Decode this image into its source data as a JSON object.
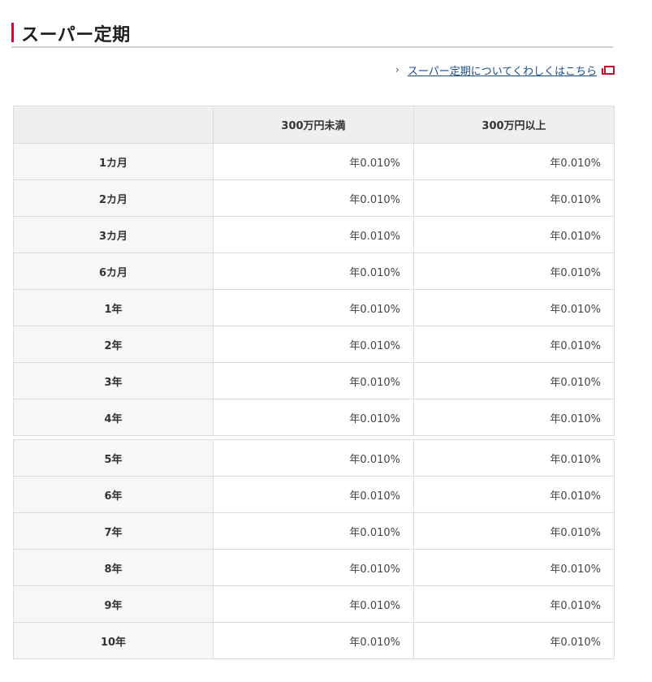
{
  "section": {
    "title": "スーパー定期"
  },
  "detail_link": {
    "chevron": "›",
    "label": "スーパー定期についてくわしくはこちら"
  },
  "table": {
    "headers": [
      "",
      "300万円未満",
      "300万円以上"
    ],
    "rows": [
      {
        "term": "1カ月",
        "under": "年0.010%",
        "over": "年0.010%"
      },
      {
        "term": "2カ月",
        "under": "年0.010%",
        "over": "年0.010%"
      },
      {
        "term": "3カ月",
        "under": "年0.010%",
        "over": "年0.010%"
      },
      {
        "term": "6カ月",
        "under": "年0.010%",
        "over": "年0.010%"
      },
      {
        "term": "1年",
        "under": "年0.010%",
        "over": "年0.010%"
      },
      {
        "term": "2年",
        "under": "年0.010%",
        "over": "年0.010%"
      },
      {
        "term": "3年",
        "under": "年0.010%",
        "over": "年0.010%"
      },
      {
        "term": "4年",
        "under": "年0.010%",
        "over": "年0.010%"
      },
      {
        "term": "5年",
        "under": "年0.010%",
        "over": "年0.010%"
      },
      {
        "term": "6年",
        "under": "年0.010%",
        "over": "年0.010%"
      },
      {
        "term": "7年",
        "under": "年0.010%",
        "over": "年0.010%"
      },
      {
        "term": "8年",
        "under": "年0.010%",
        "over": "年0.010%"
      },
      {
        "term": "9年",
        "under": "年0.010%",
        "over": "年0.010%"
      },
      {
        "term": "10年",
        "under": "年0.010%",
        "over": "年0.010%"
      }
    ]
  },
  "colors": {
    "accent": "#c8102e",
    "link": "#1a4d8c",
    "header_bg": "#efefef",
    "border": "#dcdcdc"
  }
}
